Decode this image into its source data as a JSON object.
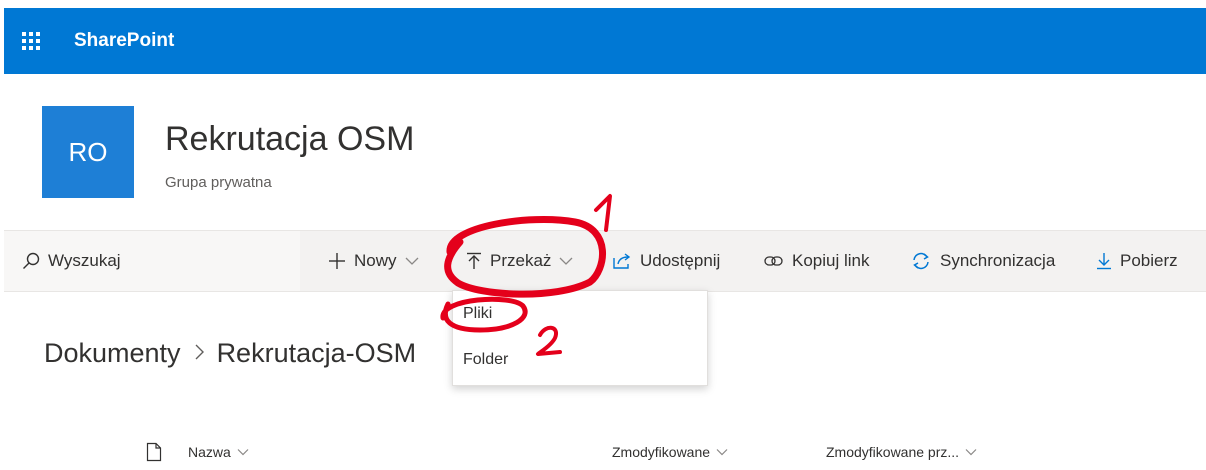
{
  "suite": {
    "brand": "SharePoint"
  },
  "site": {
    "logo_initials": "RO",
    "title": "Rekrutacja OSM",
    "subtitle": "Grupa prywatna"
  },
  "search": {
    "placeholder": "Wyszukaj"
  },
  "commands": {
    "new": "Nowy",
    "upload": "Przekaż",
    "share": "Udostępnij",
    "copy_link": "Kopiuj link",
    "sync": "Synchronizacja",
    "download": "Pobierz"
  },
  "upload_menu": {
    "files": "Pliki",
    "folder": "Folder"
  },
  "breadcrumb": {
    "root": "Dokumenty",
    "current": "Rekrutacja-OSM"
  },
  "list": {
    "col_name": "Nazwa",
    "col_modified": "Zmodyfikowane",
    "col_modified_by": "Zmodyfikowane prz..."
  },
  "annotations": {
    "step1": "1",
    "step2": "2"
  },
  "colors": {
    "suite_bar": "#0078d4",
    "site_logo": "#1e7fd6",
    "annotation": "#e4001b"
  }
}
